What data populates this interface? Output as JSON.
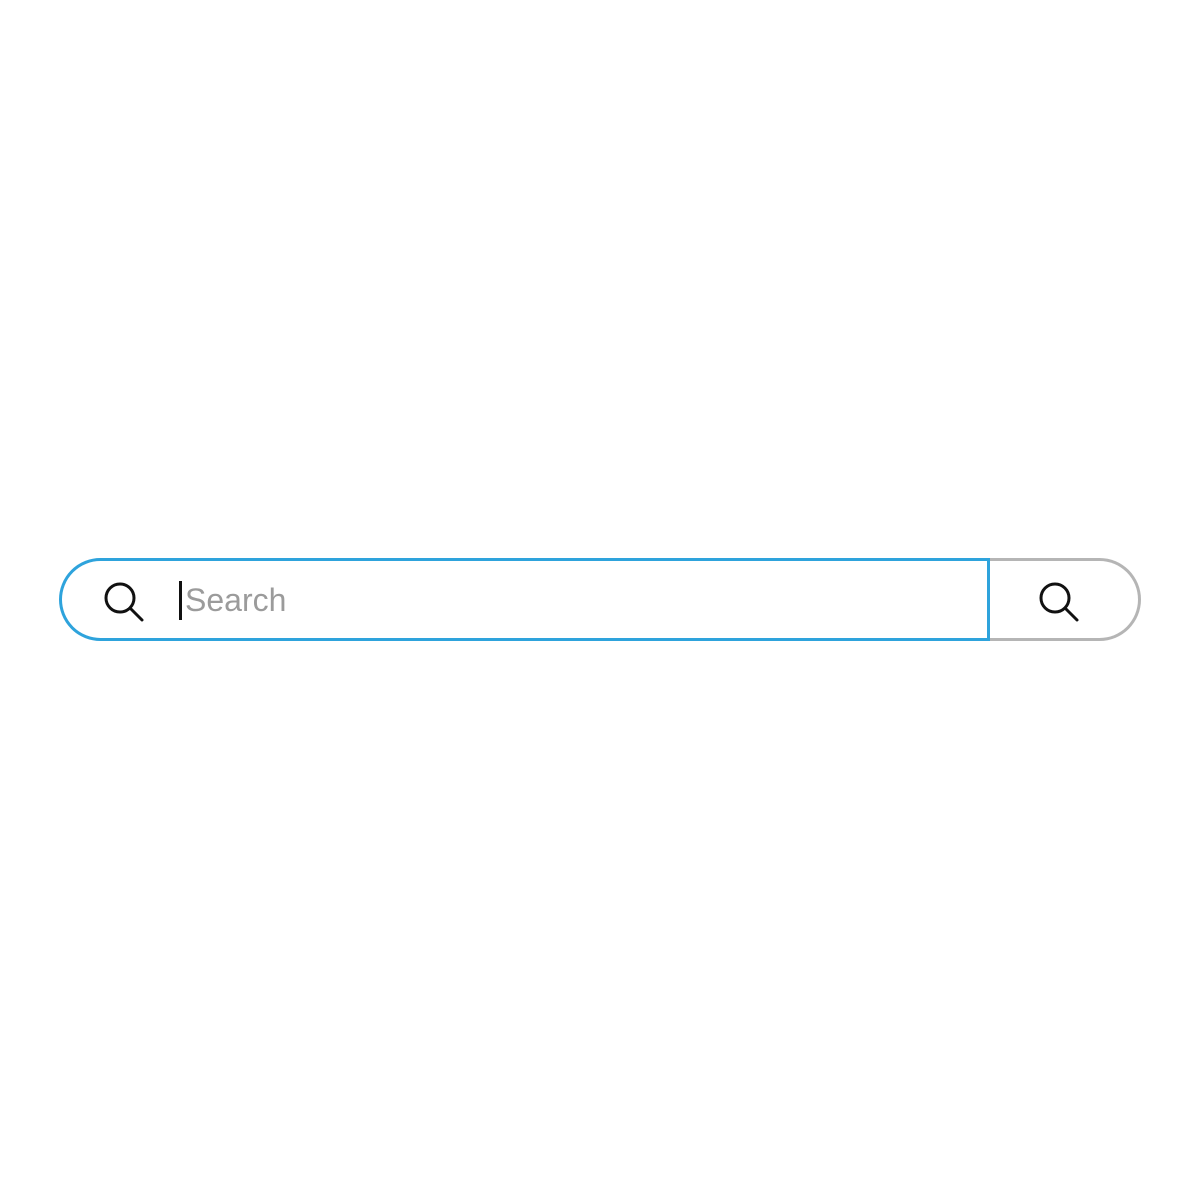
{
  "search": {
    "placeholder": "Search",
    "value": "",
    "field_icon": "search-icon",
    "button_icon": "search-icon",
    "colors": {
      "active_border": "#2ea3dc",
      "button_border": "#b5b5b5",
      "placeholder": "#9b9b9b",
      "icon": "#111111"
    }
  }
}
